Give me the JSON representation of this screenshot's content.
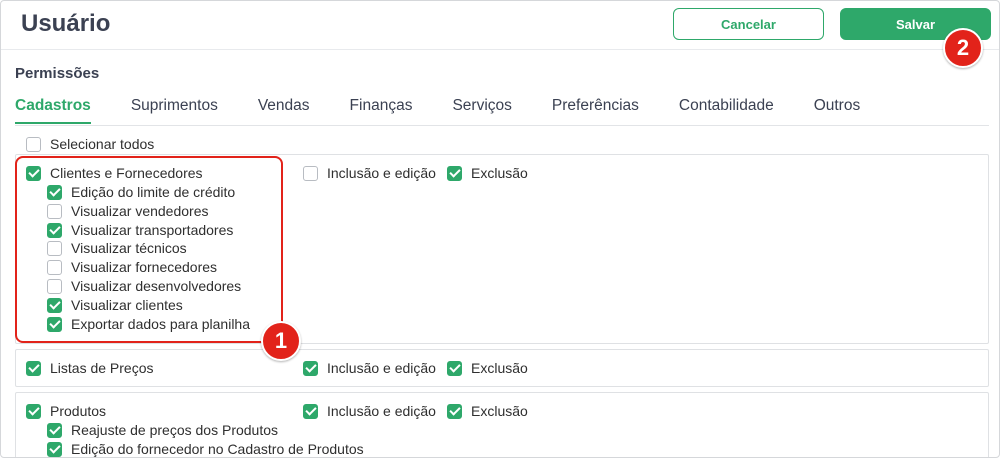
{
  "header": {
    "title": "Usuário",
    "cancel_label": "Cancelar",
    "save_label": "Salvar"
  },
  "section": {
    "label": "Permissões"
  },
  "tabs": [
    {
      "label": "Cadastros",
      "active": true
    },
    {
      "label": "Suprimentos",
      "active": false
    },
    {
      "label": "Vendas",
      "active": false
    },
    {
      "label": "Finanças",
      "active": false
    },
    {
      "label": "Serviços",
      "active": false
    },
    {
      "label": "Preferências",
      "active": false
    },
    {
      "label": "Contabilidade",
      "active": false
    },
    {
      "label": "Outros",
      "active": false
    }
  ],
  "select_all": {
    "label": "Selecionar todos",
    "checked": false
  },
  "groups": [
    {
      "label": "Clientes e Fornecedores",
      "checked": true,
      "inclusion": {
        "label": "Inclusão e edição",
        "checked": false
      },
      "exclusion": {
        "label": "Exclusão",
        "checked": true
      },
      "children": [
        {
          "label": "Edição do limite de crédito",
          "checked": true
        },
        {
          "label": "Visualizar vendedores",
          "checked": false
        },
        {
          "label": "Visualizar transportadores",
          "checked": true
        },
        {
          "label": "Visualizar técnicos",
          "checked": false
        },
        {
          "label": "Visualizar fornecedores",
          "checked": false
        },
        {
          "label": "Visualizar desenvolvedores",
          "checked": false
        },
        {
          "label": "Visualizar clientes",
          "checked": true
        },
        {
          "label": "Exportar dados para planilha",
          "checked": true
        }
      ]
    },
    {
      "label": "Listas de Preços",
      "checked": true,
      "inclusion": {
        "label": "Inclusão e edição",
        "checked": true
      },
      "exclusion": {
        "label": "Exclusão",
        "checked": true
      },
      "children": []
    },
    {
      "label": "Produtos",
      "checked": true,
      "inclusion": {
        "label": "Inclusão e edição",
        "checked": true
      },
      "exclusion": {
        "label": "Exclusão",
        "checked": true
      },
      "children": [
        {
          "label": "Reajuste de preços dos Produtos",
          "checked": true
        },
        {
          "label": "Edição do fornecedor no Cadastro de Produtos",
          "checked": true
        }
      ]
    }
  ],
  "annotations": {
    "badge_1": "1",
    "badge_2": "2",
    "highlight_color": "#e2231a"
  },
  "colors": {
    "accent": "#2ea86a",
    "title": "#3b4152"
  }
}
